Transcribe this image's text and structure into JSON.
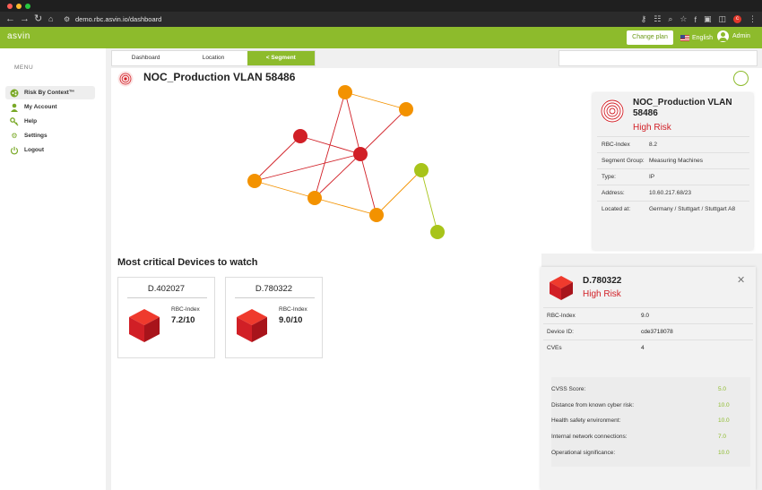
{
  "browser": {
    "url": "demo.rbc.asvin.io/dashboard",
    "profile_initial": "c"
  },
  "header": {
    "brand": "asvin",
    "change_plan": "Change plan",
    "language": "English",
    "user": "Admin"
  },
  "sidebar": {
    "title": "MENU",
    "items": [
      {
        "label": "Risk By Context™",
        "icon": "graph-icon"
      },
      {
        "label": "My Account",
        "icon": "user-icon"
      },
      {
        "label": "Help",
        "icon": "key-icon"
      },
      {
        "label": "Settings",
        "icon": "gear-icon"
      },
      {
        "label": "Logout",
        "icon": "power-icon"
      }
    ]
  },
  "tabs": [
    "Dashboard",
    "Location",
    "< Segment"
  ],
  "segment": {
    "title": "NOC_Production VLAN 58486"
  },
  "graph": {
    "node_colors": {
      "critical": "#d11f26",
      "high": "#f39200",
      "medium": "#a8c41a"
    }
  },
  "info_card": {
    "title": "NOC_Production VLAN 58486",
    "risk": "High Risk",
    "rows": [
      {
        "key": "RBC-Index",
        "value": "8.2"
      },
      {
        "key": "Segment Group:",
        "value": "Measuring Machines"
      },
      {
        "key": "Type:",
        "value": "IP"
      },
      {
        "key": "Address:",
        "value": "10.60.217.68/23"
      },
      {
        "key": "Located at:",
        "value": "Germany / Stuttgart / Stuttgart A8"
      }
    ]
  },
  "critical": {
    "title": "Most critical Devices to watch",
    "devices": [
      {
        "id": "D.402027",
        "label": "RBC-Index",
        "score": "7.2/10"
      },
      {
        "id": "D.780322",
        "label": "RBC-Index",
        "score": "9.0/10"
      }
    ]
  },
  "device_panel": {
    "title": "D.780322",
    "risk": "High Risk",
    "rows": [
      {
        "key": "RBC-Index",
        "value": "9.0"
      },
      {
        "key": "Device ID:",
        "value": "cde3718078"
      },
      {
        "key": "CVEs",
        "value": "4"
      }
    ],
    "scores": [
      {
        "key": "CVSS Score:",
        "value": "5.0"
      },
      {
        "key": "Distance from known cyber risk:",
        "value": "10.0"
      },
      {
        "key": "Health safety environment:",
        "value": "10.0"
      },
      {
        "key": "Internal network connections:",
        "value": "7.0"
      },
      {
        "key": "Operational significance:",
        "value": "10.0"
      }
    ]
  }
}
